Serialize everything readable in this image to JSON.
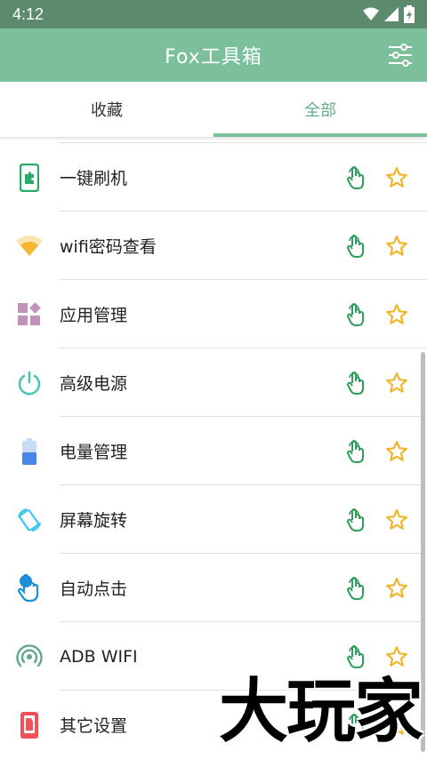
{
  "status_bar": {
    "time": "4:12"
  },
  "app_bar": {
    "title": "Fox工具箱"
  },
  "tabs": [
    {
      "label": "收藏",
      "active": false
    },
    {
      "label": "全部",
      "active": true
    }
  ],
  "tools": [
    {
      "label": "一键刷机",
      "icon": "phone-puzzle-icon"
    },
    {
      "label": "wifi密码查看",
      "icon": "wifi-icon"
    },
    {
      "label": "应用管理",
      "icon": "apps-grid-icon"
    },
    {
      "label": "高级电源",
      "icon": "power-icon"
    },
    {
      "label": "电量管理",
      "icon": "battery-icon"
    },
    {
      "label": "屏幕旋转",
      "icon": "screen-rotation-icon"
    },
    {
      "label": "自动点击",
      "icon": "auto-click-icon"
    },
    {
      "label": "ADB WIFI",
      "icon": "adb-wifi-icon"
    },
    {
      "label": "其它设置",
      "icon": "settings-phone-icon"
    }
  ],
  "colors": {
    "status_bar": "#5b8a6d",
    "app_bar": "#7bbf9b",
    "accent": "#64ad89",
    "star": "#f0b429",
    "touch": "#2e9e5a"
  },
  "watermark": "大玩家"
}
